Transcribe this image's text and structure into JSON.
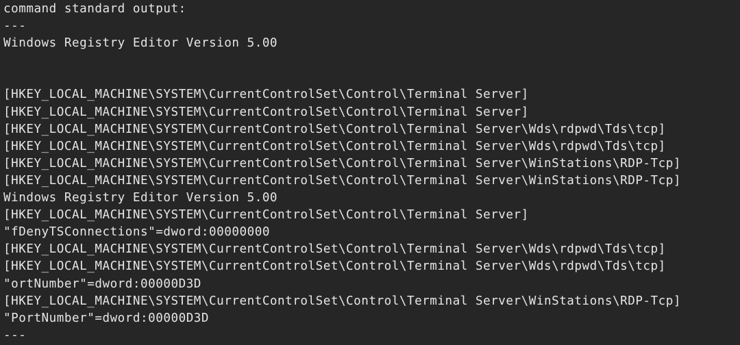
{
  "terminal": {
    "lines": [
      "command standard output:",
      "---",
      "Windows Registry Editor Version 5.00",
      "",
      "",
      "[HKEY_LOCAL_MACHINE\\SYSTEM\\CurrentControlSet\\Control\\Terminal Server]",
      "[HKEY_LOCAL_MACHINE\\SYSTEM\\CurrentControlSet\\Control\\Terminal Server]",
      "[HKEY_LOCAL_MACHINE\\SYSTEM\\CurrentControlSet\\Control\\Terminal Server\\Wds\\rdpwd\\Tds\\tcp]",
      "[HKEY_LOCAL_MACHINE\\SYSTEM\\CurrentControlSet\\Control\\Terminal Server\\Wds\\rdpwd\\Tds\\tcp]",
      "[HKEY_LOCAL_MACHINE\\SYSTEM\\CurrentControlSet\\Control\\Terminal Server\\WinStations\\RDP-Tcp]",
      "[HKEY_LOCAL_MACHINE\\SYSTEM\\CurrentControlSet\\Control\\Terminal Server\\WinStations\\RDP-Tcp]",
      "Windows Registry Editor Version 5.00",
      "[HKEY_LOCAL_MACHINE\\SYSTEM\\CurrentControlSet\\Control\\Terminal Server]",
      "\"fDenyTSConnections\"=dword:00000000",
      "[HKEY_LOCAL_MACHINE\\SYSTEM\\CurrentControlSet\\Control\\Terminal Server\\Wds\\rdpwd\\Tds\\tcp]",
      "[HKEY_LOCAL_MACHINE\\SYSTEM\\CurrentControlSet\\Control\\Terminal Server\\Wds\\rdpwd\\Tds\\tcp]",
      "\"ortNumber\"=dword:00000D3D",
      "[HKEY_LOCAL_MACHINE\\SYSTEM\\CurrentControlSet\\Control\\Terminal Server\\WinStations\\RDP-Tcp]",
      "\"PortNumber\"=dword:00000D3D",
      "---"
    ],
    "colors": {
      "background": "#262626",
      "text": "#e6e6e6"
    }
  }
}
